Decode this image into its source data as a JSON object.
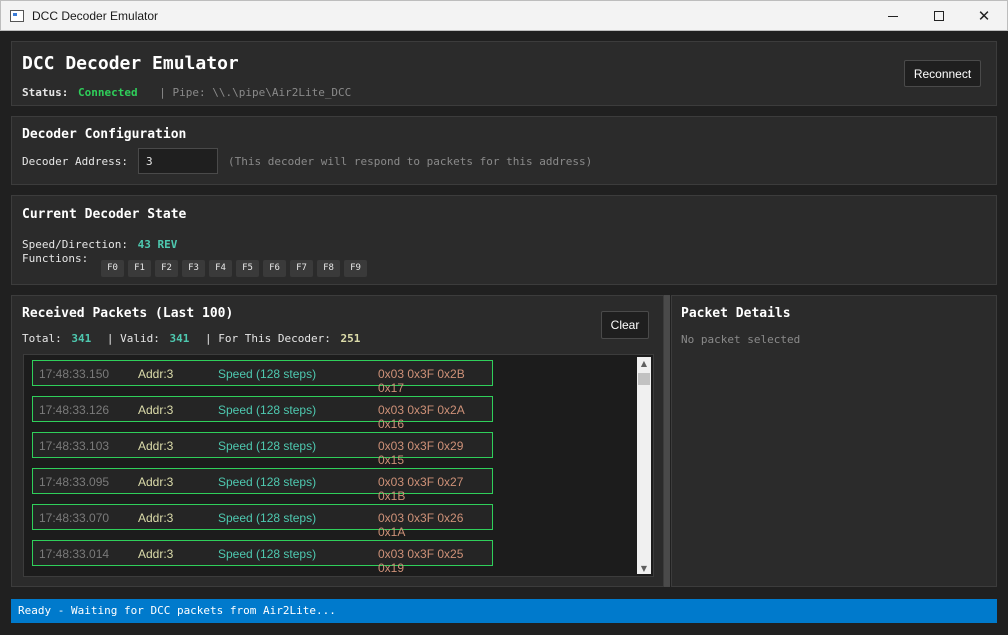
{
  "window": {
    "title": "DCC Decoder Emulator"
  },
  "header": {
    "title": "DCC Decoder Emulator",
    "status_label": "Status:",
    "status_value": "Connected",
    "pipe_text": "| Pipe: \\\\.\\pipe\\Air2Lite_DCC",
    "reconnect_label": "Reconnect"
  },
  "config": {
    "title": "Decoder Configuration",
    "address_label": "Decoder Address:",
    "address_value": "3",
    "hint": "(This decoder will respond to packets for this address)"
  },
  "state": {
    "title": "Current Decoder State",
    "speed_label": "Speed/Direction:",
    "speed_value": "43 REV",
    "functions_label": "Functions:",
    "functions": [
      "F0",
      "F1",
      "F2",
      "F3",
      "F4",
      "F5",
      "F6",
      "F7",
      "F8",
      "F9"
    ]
  },
  "packets": {
    "title": "Received Packets (Last 100)",
    "total_label": "Total:",
    "total_value": "341",
    "valid_label": "| Valid:",
    "valid_value": "341",
    "decoder_label": "| For This Decoder:",
    "decoder_value": "251",
    "clear_label": "Clear",
    "rows": [
      {
        "time": "17:48:33.150",
        "addr": "Addr:3",
        "type": "Speed (128 steps)",
        "bytes": "0x03 0x3F 0x2B 0x17"
      },
      {
        "time": "17:48:33.126",
        "addr": "Addr:3",
        "type": "Speed (128 steps)",
        "bytes": "0x03 0x3F 0x2A 0x16"
      },
      {
        "time": "17:48:33.103",
        "addr": "Addr:3",
        "type": "Speed (128 steps)",
        "bytes": "0x03 0x3F 0x29 0x15"
      },
      {
        "time": "17:48:33.095",
        "addr": "Addr:3",
        "type": "Speed (128 steps)",
        "bytes": "0x03 0x3F 0x27 0x1B"
      },
      {
        "time": "17:48:33.070",
        "addr": "Addr:3",
        "type": "Speed (128 steps)",
        "bytes": "0x03 0x3F 0x26 0x1A"
      },
      {
        "time": "17:48:33.014",
        "addr": "Addr:3",
        "type": "Speed (128 steps)",
        "bytes": "0x03 0x3F 0x25 0x19"
      }
    ]
  },
  "details": {
    "title": "Packet Details",
    "empty_text": "No packet selected"
  },
  "statusbar": {
    "text": "Ready - Waiting for DCC packets from Air2Lite..."
  },
  "colors": {
    "accent": "#007acc",
    "connected": "#2fcf5a",
    "value_teal": "#4ec9b0",
    "value_yellow": "#dcdcaa",
    "bytes": "#ce9178"
  }
}
